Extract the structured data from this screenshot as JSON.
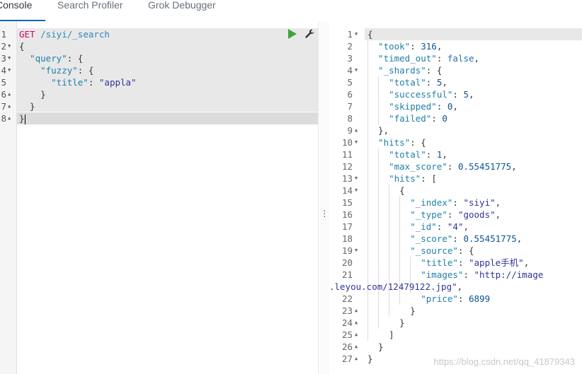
{
  "tabs": [
    {
      "label": "Console",
      "active": true
    },
    {
      "label": "Search Profiler",
      "active": false
    },
    {
      "label": "Grok Debugger",
      "active": false
    }
  ],
  "request": {
    "lines": [
      {
        "n": "1",
        "fold": "",
        "tokens": [
          {
            "t": "GET ",
            "c": "c-method"
          },
          {
            "t": "/siyi/_search",
            "c": "c-url"
          }
        ]
      },
      {
        "n": "2",
        "fold": "▼",
        "tokens": [
          {
            "t": "{",
            "c": "c-p"
          }
        ]
      },
      {
        "n": "3",
        "fold": "▼",
        "tokens": [
          {
            "t": "  \"query\"",
            "c": "c-key"
          },
          {
            "t": ": {",
            "c": "c-p"
          }
        ]
      },
      {
        "n": "4",
        "fold": "▼",
        "tokens": [
          {
            "t": "    \"fuzzy\"",
            "c": "c-key"
          },
          {
            "t": ": {",
            "c": "c-p"
          }
        ]
      },
      {
        "n": "5",
        "fold": "",
        "tokens": [
          {
            "t": "      \"title\"",
            "c": "c-key"
          },
          {
            "t": ": ",
            "c": "c-p"
          },
          {
            "t": "\"appla\"",
            "c": "c-str"
          }
        ]
      },
      {
        "n": "6",
        "fold": "▲",
        "tokens": [
          {
            "t": "    }",
            "c": "c-p"
          }
        ]
      },
      {
        "n": "7",
        "fold": "▲",
        "tokens": [
          {
            "t": "  }",
            "c": "c-p"
          }
        ]
      },
      {
        "n": "8",
        "fold": "▲",
        "tokens": [
          {
            "t": "}",
            "c": "c-p"
          }
        ]
      }
    ]
  },
  "response": {
    "lines": [
      {
        "n": "1",
        "fold": "▼",
        "tokens": [
          {
            "t": "{",
            "c": "c-p"
          }
        ]
      },
      {
        "n": "2",
        "fold": "",
        "tokens": [
          {
            "t": "  \"took\"",
            "c": "c-key"
          },
          {
            "t": ": ",
            "c": "c-p"
          },
          {
            "t": "316",
            "c": "c-num"
          },
          {
            "t": ",",
            "c": "c-p"
          }
        ]
      },
      {
        "n": "3",
        "fold": "",
        "tokens": [
          {
            "t": "  \"timed_out\"",
            "c": "c-key"
          },
          {
            "t": ": ",
            "c": "c-p"
          },
          {
            "t": "false",
            "c": "c-bool"
          },
          {
            "t": ",",
            "c": "c-p"
          }
        ]
      },
      {
        "n": "4",
        "fold": "▼",
        "tokens": [
          {
            "t": "  \"_shards\"",
            "c": "c-key"
          },
          {
            "t": ": {",
            "c": "c-p"
          }
        ]
      },
      {
        "n": "5",
        "fold": "",
        "tokens": [
          {
            "t": "    \"total\"",
            "c": "c-key"
          },
          {
            "t": ": ",
            "c": "c-p"
          },
          {
            "t": "5",
            "c": "c-num"
          },
          {
            "t": ",",
            "c": "c-p"
          }
        ]
      },
      {
        "n": "6",
        "fold": "",
        "tokens": [
          {
            "t": "    \"successful\"",
            "c": "c-key"
          },
          {
            "t": ": ",
            "c": "c-p"
          },
          {
            "t": "5",
            "c": "c-num"
          },
          {
            "t": ",",
            "c": "c-p"
          }
        ]
      },
      {
        "n": "7",
        "fold": "",
        "tokens": [
          {
            "t": "    \"skipped\"",
            "c": "c-key"
          },
          {
            "t": ": ",
            "c": "c-p"
          },
          {
            "t": "0",
            "c": "c-num"
          },
          {
            "t": ",",
            "c": "c-p"
          }
        ]
      },
      {
        "n": "8",
        "fold": "",
        "tokens": [
          {
            "t": "    \"failed\"",
            "c": "c-key"
          },
          {
            "t": ": ",
            "c": "c-p"
          },
          {
            "t": "0",
            "c": "c-num"
          }
        ]
      },
      {
        "n": "9",
        "fold": "▲",
        "tokens": [
          {
            "t": "  },",
            "c": "c-p"
          }
        ]
      },
      {
        "n": "10",
        "fold": "▼",
        "tokens": [
          {
            "t": "  \"hits\"",
            "c": "c-key"
          },
          {
            "t": ": {",
            "c": "c-p"
          }
        ]
      },
      {
        "n": "11",
        "fold": "",
        "tokens": [
          {
            "t": "    \"total\"",
            "c": "c-key"
          },
          {
            "t": ": ",
            "c": "c-p"
          },
          {
            "t": "1",
            "c": "c-num"
          },
          {
            "t": ",",
            "c": "c-p"
          }
        ]
      },
      {
        "n": "12",
        "fold": "",
        "tokens": [
          {
            "t": "    \"max_score\"",
            "c": "c-key"
          },
          {
            "t": ": ",
            "c": "c-p"
          },
          {
            "t": "0.55451775",
            "c": "c-num"
          },
          {
            "t": ",",
            "c": "c-p"
          }
        ]
      },
      {
        "n": "13",
        "fold": "▼",
        "tokens": [
          {
            "t": "    \"hits\"",
            "c": "c-key"
          },
          {
            "t": ": [",
            "c": "c-p"
          }
        ]
      },
      {
        "n": "14",
        "fold": "▼",
        "tokens": [
          {
            "t": "      {",
            "c": "c-p"
          }
        ]
      },
      {
        "n": "15",
        "fold": "",
        "tokens": [
          {
            "t": "        \"_index\"",
            "c": "c-key"
          },
          {
            "t": ": ",
            "c": "c-p"
          },
          {
            "t": "\"siyi\"",
            "c": "c-str"
          },
          {
            "t": ",",
            "c": "c-p"
          }
        ]
      },
      {
        "n": "16",
        "fold": "",
        "tokens": [
          {
            "t": "        \"_type\"",
            "c": "c-key"
          },
          {
            "t": ": ",
            "c": "c-p"
          },
          {
            "t": "\"goods\"",
            "c": "c-str"
          },
          {
            "t": ",",
            "c": "c-p"
          }
        ]
      },
      {
        "n": "17",
        "fold": "",
        "tokens": [
          {
            "t": "        \"_id\"",
            "c": "c-key"
          },
          {
            "t": ": ",
            "c": "c-p"
          },
          {
            "t": "\"4\"",
            "c": "c-str"
          },
          {
            "t": ",",
            "c": "c-p"
          }
        ]
      },
      {
        "n": "18",
        "fold": "",
        "tokens": [
          {
            "t": "        \"_score\"",
            "c": "c-key"
          },
          {
            "t": ": ",
            "c": "c-p"
          },
          {
            "t": "0.55451775",
            "c": "c-num"
          },
          {
            "t": ",",
            "c": "c-p"
          }
        ]
      },
      {
        "n": "19",
        "fold": "▼",
        "tokens": [
          {
            "t": "        \"_source\"",
            "c": "c-key"
          },
          {
            "t": ": {",
            "c": "c-p"
          }
        ]
      },
      {
        "n": "20",
        "fold": "",
        "tokens": [
          {
            "t": "          \"title\"",
            "c": "c-key"
          },
          {
            "t": ": ",
            "c": "c-p"
          },
          {
            "t": "\"apple手机\"",
            "c": "c-str"
          },
          {
            "t": ",",
            "c": "c-p"
          }
        ]
      },
      {
        "n": "21",
        "fold": "",
        "tokens": [
          {
            "t": "          \"images\"",
            "c": "c-key"
          },
          {
            "t": ": ",
            "c": "c-p"
          },
          {
            "t": "\"http://image",
            "c": "c-str"
          }
        ]
      },
      {
        "n": "",
        "fold": "",
        "wrap": true,
        "tokens": [
          {
            "t": ".leyou.com/12479122.jpg\"",
            "c": "c-str"
          },
          {
            "t": ",",
            "c": "c-p"
          }
        ]
      },
      {
        "n": "22",
        "fold": "",
        "tokens": [
          {
            "t": "          \"price\"",
            "c": "c-key"
          },
          {
            "t": ": ",
            "c": "c-p"
          },
          {
            "t": "6899",
            "c": "c-num"
          }
        ]
      },
      {
        "n": "23",
        "fold": "▲",
        "tokens": [
          {
            "t": "        }",
            "c": "c-p"
          }
        ]
      },
      {
        "n": "24",
        "fold": "▲",
        "tokens": [
          {
            "t": "      }",
            "c": "c-p"
          }
        ]
      },
      {
        "n": "25",
        "fold": "▲",
        "tokens": [
          {
            "t": "    ]",
            "c": "c-p"
          }
        ]
      },
      {
        "n": "26",
        "fold": "▲",
        "tokens": [
          {
            "t": "  }",
            "c": "c-p"
          }
        ]
      },
      {
        "n": "27",
        "fold": "▲",
        "tokens": [
          {
            "t": "}",
            "c": "c-p"
          }
        ]
      }
    ]
  },
  "icons": {
    "run": "play-icon",
    "settings": "wrench-icon",
    "resize": "grip-icon"
  },
  "watermark": "https://blog.csdn.net/qq_41879343",
  "colors": {
    "accent": "#006bb4",
    "run": "#3ca43c",
    "method": "#c80a68"
  }
}
